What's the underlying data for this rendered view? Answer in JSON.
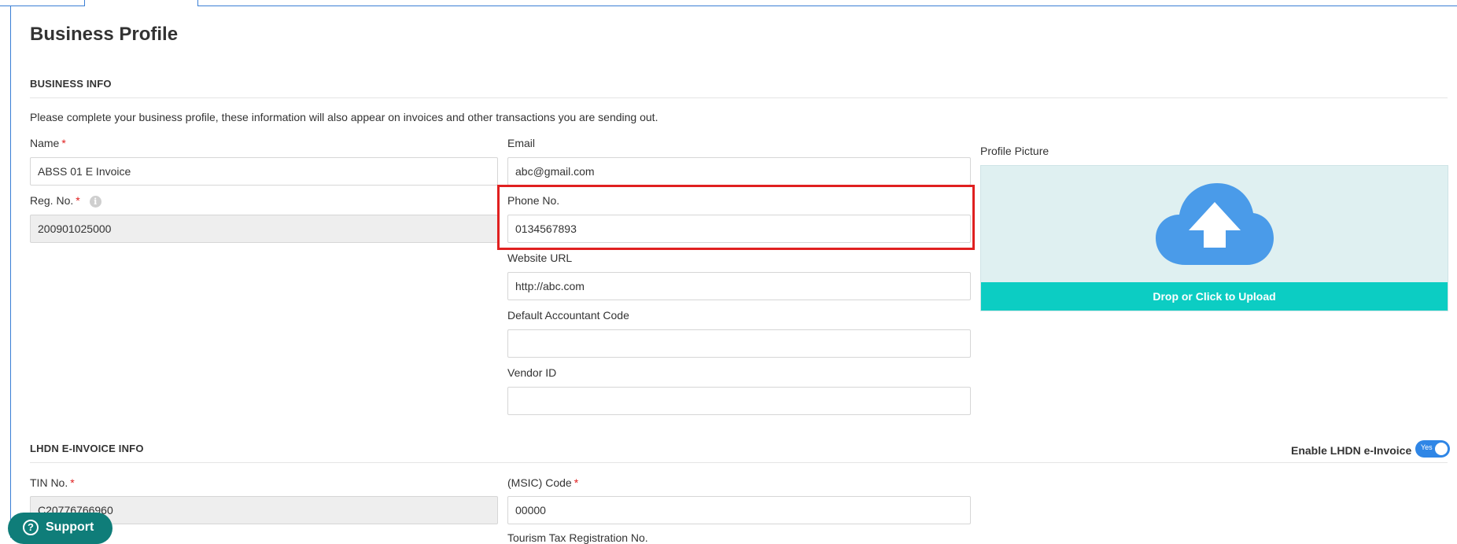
{
  "page": {
    "title": "Business Profile"
  },
  "business_info": {
    "section_title": "BUSINESS INFO",
    "intro": "Please complete your business profile, these information will also appear on invoices and other transactions you are sending out.",
    "name": {
      "label": "Name",
      "required_mark": "*",
      "value": "ABSS 01 E Invoice"
    },
    "reg_no": {
      "label": "Reg. No.",
      "required_mark": "*",
      "info_icon": "info-icon",
      "value": "200901025000"
    },
    "email": {
      "label": "Email",
      "value": "abc@gmail.com"
    },
    "phone": {
      "label": "Phone No.",
      "value": "0134567893"
    },
    "website": {
      "label": "Website URL",
      "value": "http://abc.com"
    },
    "accountant_code": {
      "label": "Default Accountant Code",
      "value": ""
    },
    "vendor_id": {
      "label": "Vendor ID",
      "value": ""
    },
    "profile_picture": {
      "label": "Profile Picture",
      "upload_text": "Drop or Click to Upload",
      "icon": "cloud-upload-icon"
    }
  },
  "lhdn": {
    "section_title": "LHDN E-INVOICE INFO",
    "toggle_label": "Enable LHDN e-Invoice",
    "toggle_text": "Yes",
    "toggle_on": true,
    "tin": {
      "label": "TIN No.",
      "required_mark": "*",
      "value": "C20776766960"
    },
    "msic": {
      "label": "(MSIC) Code",
      "required_mark": "*",
      "value": "00000"
    },
    "next_label_partial": "Tourism Tax Registration No."
  },
  "support": {
    "label": "Support",
    "icon": "question-circle-icon"
  },
  "colors": {
    "accent_blue": "#3a7fd5",
    "required_red": "#e02020",
    "highlight_red": "#e02020",
    "upload_bar": "#0ccdc3",
    "upload_bg": "#dff0f1",
    "cloud_blue": "#4a9be9",
    "toggle_on": "#2f86e6",
    "support_bg": "#0f7d79"
  }
}
